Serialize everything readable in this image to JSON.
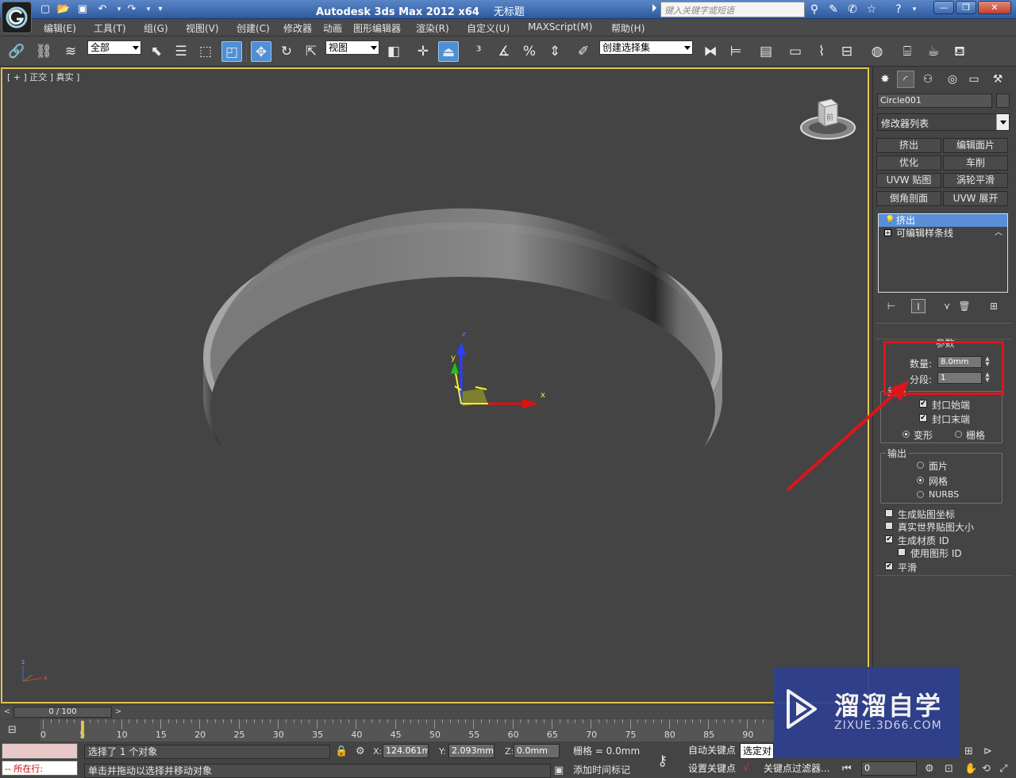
{
  "titlebar": {
    "app_title": "Autodesk 3ds Max  2012 x64",
    "doc_title": "无标题",
    "search_placeholder": "键入关键字或短语",
    "minimize": "—",
    "restore": "❐",
    "close": "✕"
  },
  "menu": [
    "编辑(E)",
    "工具(T)",
    "组(G)",
    "视图(V)",
    "创建(C)",
    "修改器",
    "动画",
    "图形编辑器",
    "渲染(R)",
    "自定义(U)",
    "MAXScript(M)",
    "帮助(H)"
  ],
  "toolbar": {
    "selection_filter": "全部",
    "ref_coord": "视图",
    "named_selection": "创建选择集"
  },
  "viewport": {
    "label": "[ + ] 正交 ] 真实 ]",
    "axis_x": "x",
    "axis_y": "y",
    "axis_z": "z",
    "viewcube_face": "前"
  },
  "command_panel": {
    "object_name": "Circle001",
    "modifier_list": "修改器列表",
    "modifier_buttons": [
      "挤出",
      "编辑面片",
      "优化",
      "车削",
      "UVW 贴图",
      "涡轮平滑",
      "倒角剖面",
      "UVW 展开"
    ],
    "stack": [
      {
        "label": "挤出",
        "selected": true
      },
      {
        "label": "可编辑样条线",
        "selected": false
      }
    ],
    "params_title": "参数",
    "amount_label": "数量:",
    "amount_value": "8.0mm",
    "segments_label": "分段:",
    "segments_value": "1",
    "capping_title": "封口",
    "cap_start": "封口始端",
    "cap_end": "封口末端",
    "morph": "变形",
    "grid": "栅格",
    "output_title": "输出",
    "output_patch": "面片",
    "output_mesh": "网格",
    "output_nurbs": "NURBS",
    "gen_mapping": "生成贴图坐标",
    "real_world": "真实世界贴图大小",
    "gen_matid": "生成材质 ID",
    "use_shape_id": "使用图形 ID",
    "smooth": "平滑",
    "cap_start_checked": true,
    "cap_end_checked": true,
    "gen_mapping_checked": false,
    "real_world_checked": false,
    "gen_matid_checked": true,
    "use_shape_id_checked": false,
    "smooth_checked": true,
    "morph_selected": true,
    "output_selected": "网格"
  },
  "timeline": {
    "slider_text": "0 / 100",
    "ticks": [
      "0",
      "5",
      "10",
      "15",
      "20",
      "25",
      "30",
      "35",
      "40",
      "45",
      "50",
      "55",
      "60",
      "65",
      "70",
      "75",
      "80",
      "85",
      "90"
    ]
  },
  "status": {
    "listener_label": "-- 所在行:",
    "selection_info": "选择了 1 个对象",
    "prompt": "单击并拖动以选择并移动对象",
    "x_label": "X:",
    "x_value": "124.061mm",
    "y_label": "Y:",
    "y_value": "2.093mm",
    "z_label": "Z:",
    "z_value": "0.0mm",
    "grid": "栅格 = 0.0mm",
    "add_time_tag": "添加时间标记",
    "auto_key": "自动关键点",
    "set_key": "设置关键点",
    "selected_drop": "选定对",
    "key_filters": "关键点过滤器...",
    "frame_value": "0"
  },
  "watermark": {
    "brand": "溜溜自学",
    "url": "ZIXUE.3D66.COM"
  },
  "colors": {
    "viewport_border": "#e2c44c",
    "highlight": "#e0141c",
    "selection_blue": "#5a8fd8"
  }
}
